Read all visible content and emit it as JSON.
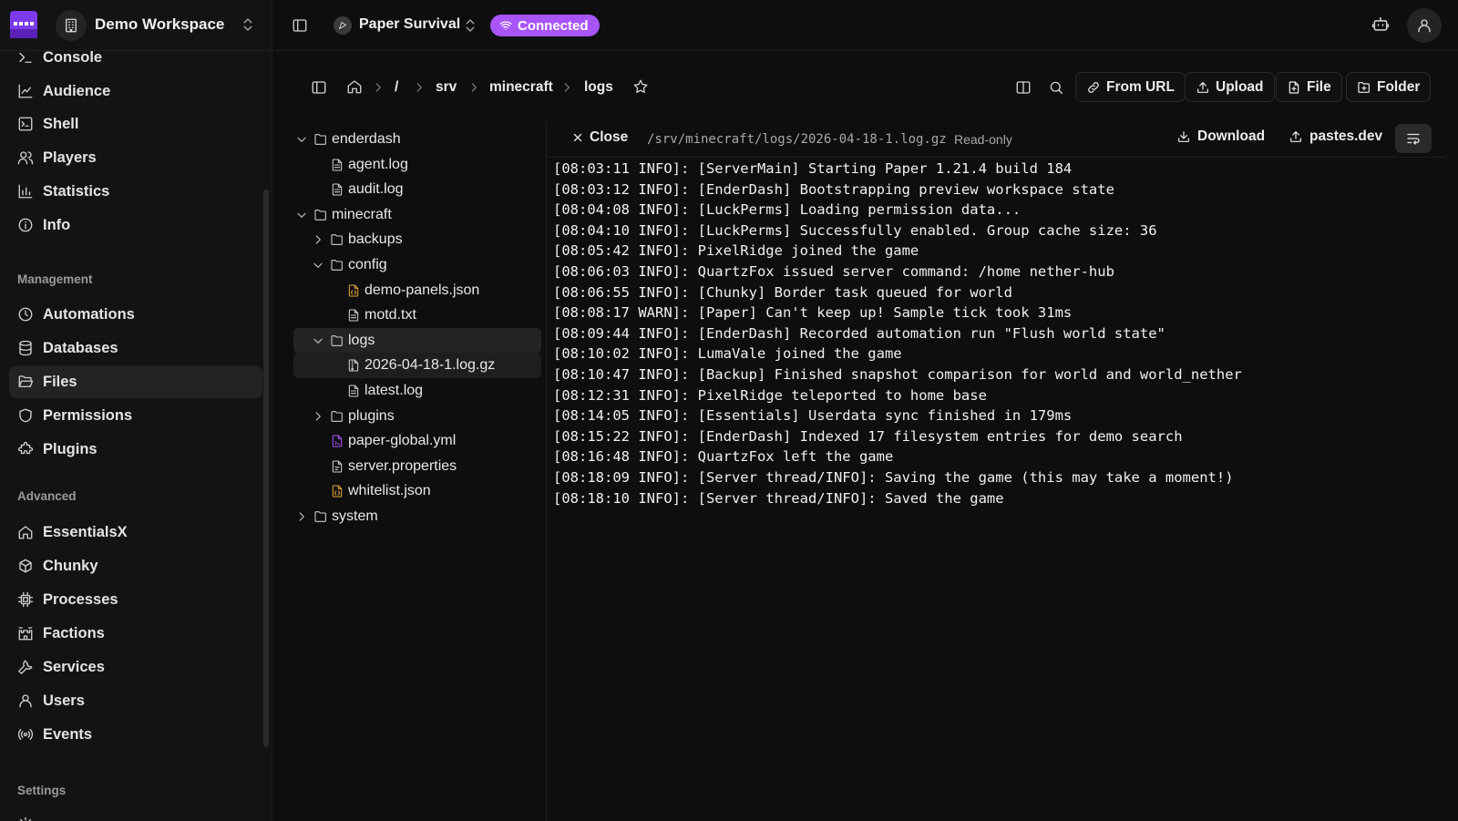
{
  "workspace": {
    "name": "Demo Workspace"
  },
  "sidebar": {
    "items": [
      {
        "label": "Console",
        "icon": "terminal-icon"
      },
      {
        "label": "Audience",
        "icon": "chart-line-icon"
      },
      {
        "label": "Shell",
        "icon": "shell-icon"
      },
      {
        "label": "Players",
        "icon": "users-icon"
      },
      {
        "label": "Statistics",
        "icon": "bar-chart-icon"
      },
      {
        "label": "Info",
        "icon": "info-icon"
      }
    ],
    "management_header": "Management",
    "management": [
      {
        "label": "Automations",
        "icon": "clock-icon"
      },
      {
        "label": "Databases",
        "icon": "database-icon"
      },
      {
        "label": "Files",
        "icon": "folder-open-icon",
        "active": true
      },
      {
        "label": "Permissions",
        "icon": "shield-icon"
      },
      {
        "label": "Plugins",
        "icon": "puzzle-icon"
      }
    ],
    "advanced_header": "Advanced",
    "advanced": [
      {
        "label": "EssentialsX",
        "icon": "home-icon"
      },
      {
        "label": "Chunky",
        "icon": "cube-icon"
      },
      {
        "label": "Processes",
        "icon": "cpu-icon"
      },
      {
        "label": "Factions",
        "icon": "castle-icon"
      },
      {
        "label": "Services",
        "icon": "wrench-icon"
      },
      {
        "label": "Users",
        "icon": "user-icon"
      },
      {
        "label": "Events",
        "icon": "broadcast-icon"
      }
    ],
    "settings_header": "Settings"
  },
  "topbar": {
    "server_name": "Paper Survival",
    "status": "Connected",
    "status_color": "#a855f7"
  },
  "breadcrumb": {
    "root": "/",
    "parts": [
      "srv",
      "minecraft",
      "logs"
    ]
  },
  "toolbar": {
    "from_url": "From URL",
    "upload": "Upload",
    "file": "File",
    "folder": "Folder"
  },
  "tree": [
    {
      "name": "enderdash",
      "type": "folder",
      "expanded": true
    },
    {
      "name": "agent.log",
      "type": "file"
    },
    {
      "name": "audit.log",
      "type": "file"
    },
    {
      "name": "minecraft",
      "type": "folder",
      "expanded": true
    },
    {
      "name": "backups",
      "type": "folder",
      "expanded": false
    },
    {
      "name": "config",
      "type": "folder",
      "expanded": true
    },
    {
      "name": "demo-panels.json",
      "type": "json"
    },
    {
      "name": "motd.txt",
      "type": "file"
    },
    {
      "name": "logs",
      "type": "folder",
      "expanded": true
    },
    {
      "name": "2026-04-18-1.log.gz",
      "type": "archive"
    },
    {
      "name": "latest.log",
      "type": "file"
    },
    {
      "name": "plugins",
      "type": "folder",
      "expanded": false
    },
    {
      "name": "paper-global.yml",
      "type": "yaml"
    },
    {
      "name": "server.properties",
      "type": "config"
    },
    {
      "name": "whitelist.json",
      "type": "json"
    },
    {
      "name": "system",
      "type": "folder",
      "expanded": false
    }
  ],
  "viewer": {
    "close_label": "Close",
    "path": "/srv/minecraft/logs/2026-04-18-1.log.gz",
    "mode": "Read-only",
    "download_label": "Download",
    "paste_label": "pastes.dev",
    "lines": [
      "[08:03:11 INFO]: [ServerMain] Starting Paper 1.21.4 build 184",
      "[08:03:12 INFO]: [EnderDash] Bootstrapping preview workspace state",
      "[08:04:08 INFO]: [LuckPerms] Loading permission data...",
      "[08:04:10 INFO]: [LuckPerms] Successfully enabled. Group cache size: 36",
      "[08:05:42 INFO]: PixelRidge joined the game",
      "[08:06:03 INFO]: QuartzFox issued server command: /home nether-hub",
      "[08:06:55 INFO]: [Chunky] Border task queued for world",
      "[08:08:17 WARN]: [Paper] Can't keep up! Sample tick took 31ms",
      "[08:09:44 INFO]: [EnderDash] Recorded automation run \"Flush world state\"",
      "[08:10:02 INFO]: LumaVale joined the game",
      "[08:10:47 INFO]: [Backup] Finished snapshot comparison for world and world_nether",
      "[08:12:31 INFO]: PixelRidge teleported to home base",
      "[08:14:05 INFO]: [Essentials] Userdata sync finished in 179ms",
      "[08:15:22 INFO]: [EnderDash] Indexed 17 filesystem entries for demo search",
      "[08:16:48 INFO]: QuartzFox left the game",
      "[08:18:09 INFO]: [Server thread/INFO]: Saving the game (this may take a moment!)",
      "[08:18:10 INFO]: [Server thread/INFO]: Saved the game"
    ]
  },
  "colors": {
    "accent": "#a855f7",
    "json_icon": "#e0a33c",
    "yaml_icon": "#a855f7"
  }
}
